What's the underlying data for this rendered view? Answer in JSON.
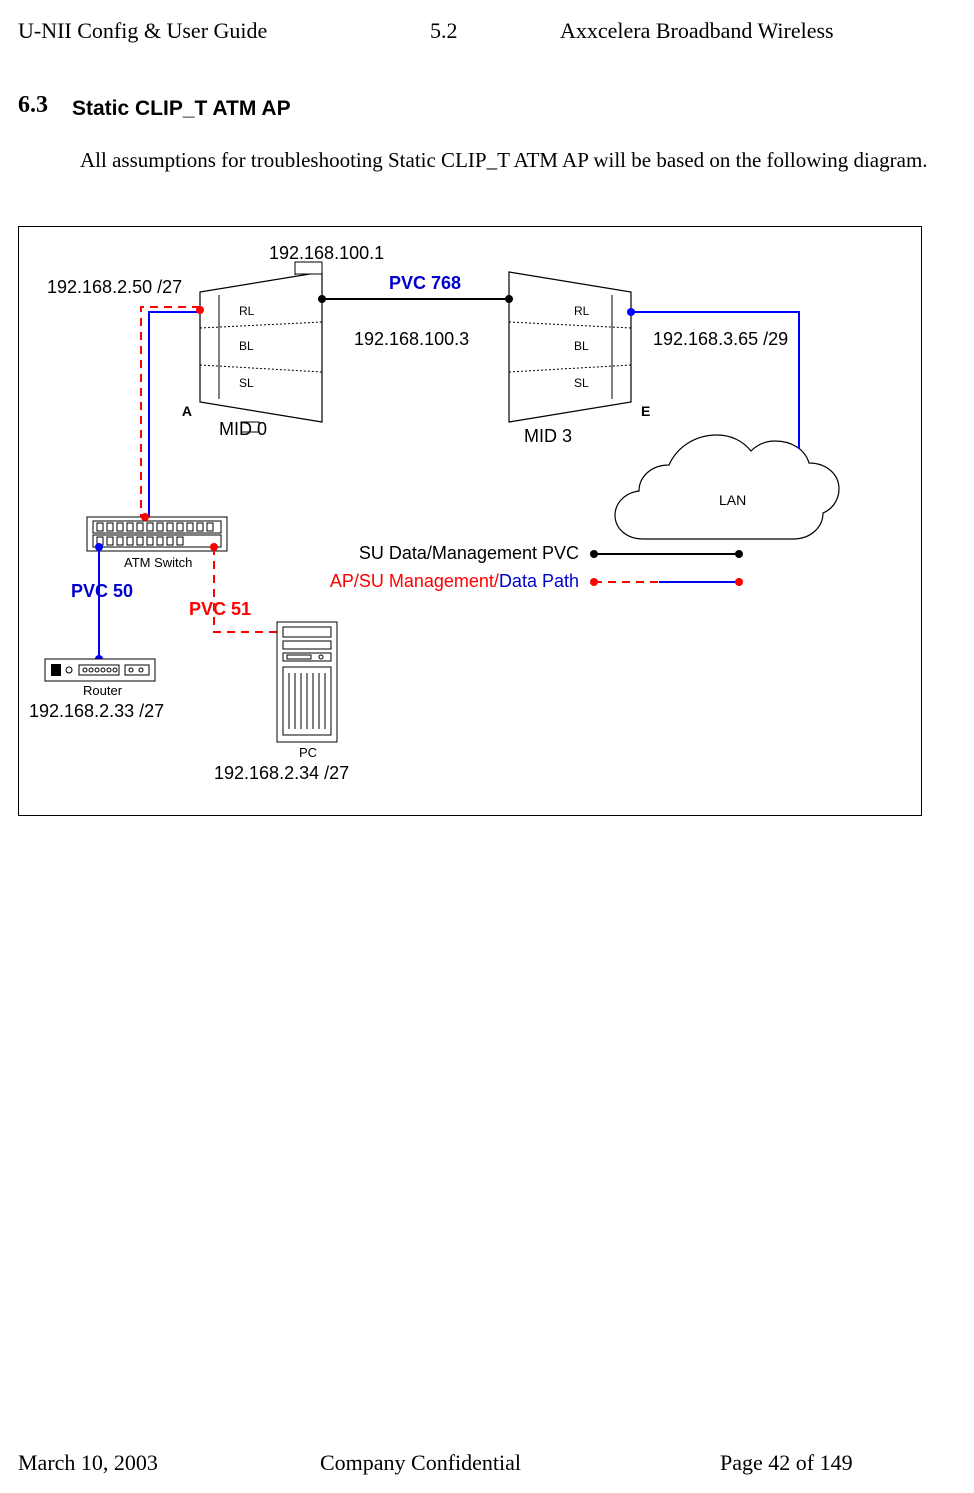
{
  "header": {
    "left": "U-NII Config & User Guide",
    "mid": "5.2",
    "right": "Axxcelera Broadband Wireless"
  },
  "section": {
    "num": "6.3",
    "title": "Static CLIP_T ATM AP"
  },
  "paragraph": "All assumptions for troubleshooting Static CLIP_T ATM AP will be based on the following diagram.",
  "diagram": {
    "labels": {
      "ip_ap_radio": "192.168.100.1",
      "ip_ap_eth": "192.168.2.50  /27",
      "pvc768": "PVC 768",
      "ip_su_radio": "192.168.100.3",
      "ip_su_eth": "192.168.3.65 /29",
      "A": "A",
      "E": "E",
      "rl": "RL",
      "bl": "BL",
      "sl": "SL",
      "mid0": "MID 0",
      "mid3": "MID 3",
      "lan": "LAN",
      "atm": "ATM Switch",
      "pvc50": "PVC 50",
      "pvc51": "PVC 51",
      "router": "Router",
      "ip_router": "192.168.2.33  /27",
      "pc": "PC",
      "ip_pc": "192.168.2.34  /27",
      "legend1": "SU Data/Management PVC",
      "legend2a": "AP/SU  ",
      "legend2b": "Management/",
      "legend2c": "Data Path"
    }
  },
  "footer": {
    "left": "March 10, 2003",
    "mid": "Company Confidential",
    "right": "Page 42 of 149"
  }
}
